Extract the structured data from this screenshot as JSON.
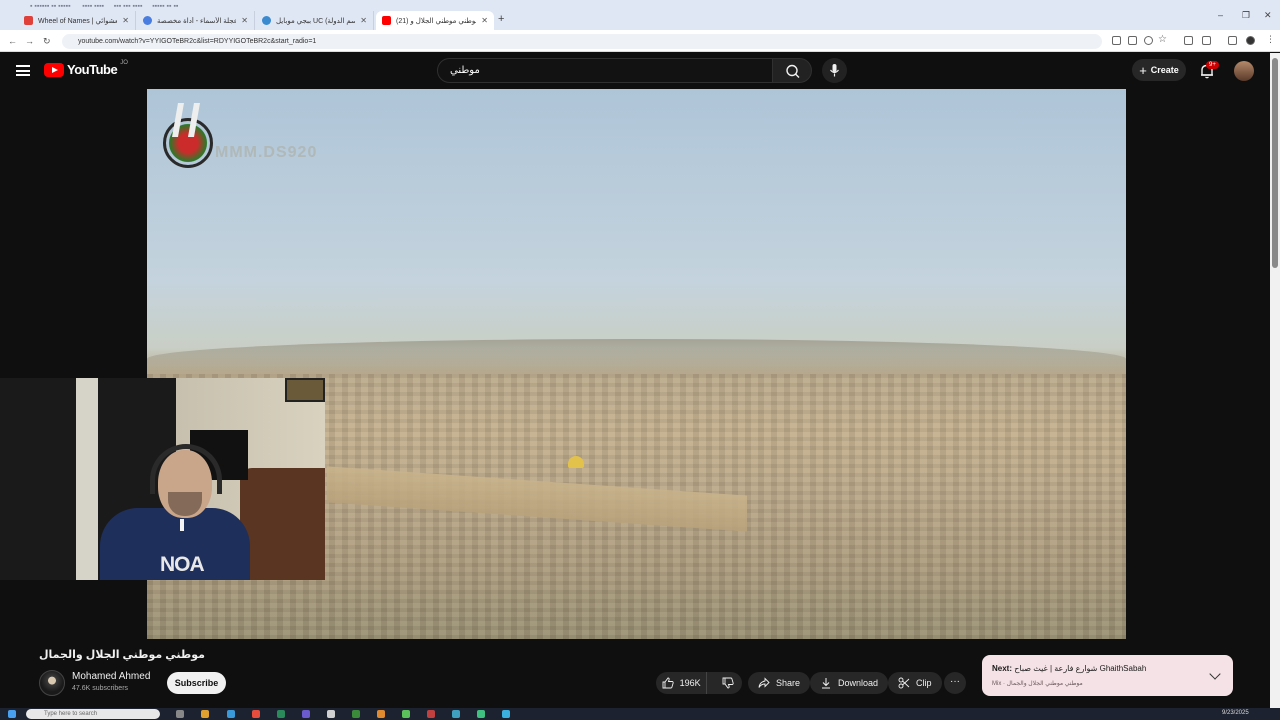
{
  "browser": {
    "tabs": [
      {
        "title": "Wheel of Names | عجلة الاسم العشوائي",
        "favicon_color": "#e0403a"
      },
      {
        "title": "برنامج عجلة الأسماء - أداة مخصصة...",
        "favicon_color": "#4a7de0"
      },
      {
        "title": "ببجي موبايل UC (اسم الدولة) | دي...",
        "favicon_color": "#3a8ad0"
      },
      {
        "title": "(21) موطني موطني الجلال و...",
        "favicon_color": "#ff0000"
      }
    ],
    "url": "youtube.com/watch?v=YYIGOTeBR2c&list=RDYYIGOTeBR2c&start_radio=1"
  },
  "header": {
    "logo_text": "YouTube",
    "country_code": "JO",
    "search_value": "موطني",
    "create_label": "Create",
    "notification_badge": "9+"
  },
  "video": {
    "watermark_text": "MMM.DS920",
    "title": "موطني موطني الجلال والجمال"
  },
  "channel": {
    "name": "Mohamed Ahmed",
    "subscribers": "47.6K subscribers",
    "subscribe_label": "Subscribe"
  },
  "actions": {
    "like_count": "196K",
    "share_label": "Share",
    "download_label": "Download",
    "clip_label": "Clip",
    "more_label": "···"
  },
  "next": {
    "prefix": "Next:",
    "title": "شوارع فارعة | غيث صباح GhaithSabah",
    "subtitle": "Mix · موطني موطني الجلال والجمال"
  },
  "webcam": {
    "shirt_text": "NOA"
  },
  "taskbar": {
    "search_placeholder": "Type here to search",
    "date": "9/23/2025"
  },
  "colors": {
    "accent": "#ff0000",
    "background": "#0f0f0f",
    "next_card": "#f5e2e6"
  }
}
